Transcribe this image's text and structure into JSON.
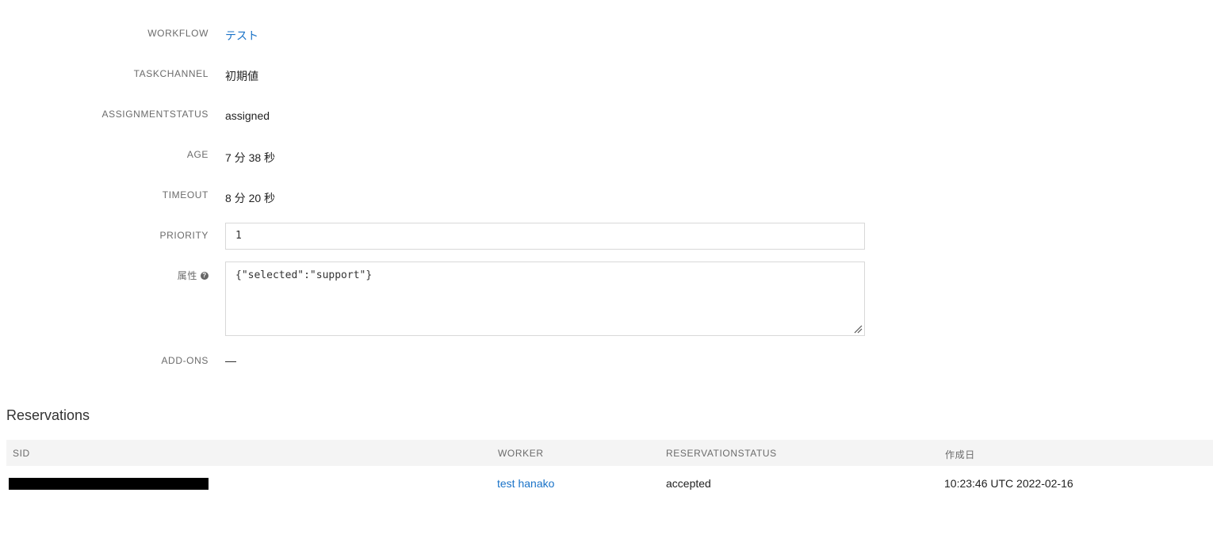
{
  "details": {
    "workflow": {
      "label": "WORKFLOW",
      "value": "テスト"
    },
    "taskchannel": {
      "label": "TASKCHANNEL",
      "value": "初期値"
    },
    "assignment_status": {
      "label": "ASSIGNMENTSTATUS",
      "value": "assigned"
    },
    "age": {
      "label": "AGE",
      "value": "7 分 38 秒"
    },
    "timeout": {
      "label": "TIMEOUT",
      "value": "8 分 20 秒"
    },
    "priority": {
      "label": "PRIORITY",
      "value": "1"
    },
    "attributes": {
      "label": "属性",
      "value": "{\"selected\":\"support\"}",
      "help_icon": "question-circle-icon"
    },
    "addons": {
      "label": "ADD-ONS",
      "value": "—"
    }
  },
  "reservations": {
    "title": "Reservations",
    "columns": [
      "SID",
      "WORKER",
      "RESERVATIONSTATUS",
      "作成日"
    ],
    "rows": [
      {
        "sid": "",
        "worker": "test hanako",
        "status": "accepted",
        "created": "10:23:46 UTC 2022-02-16"
      }
    ]
  },
  "colors": {
    "link": "#1a73c8",
    "label": "#6b6b6b",
    "header_bg": "#f4f4f4"
  }
}
